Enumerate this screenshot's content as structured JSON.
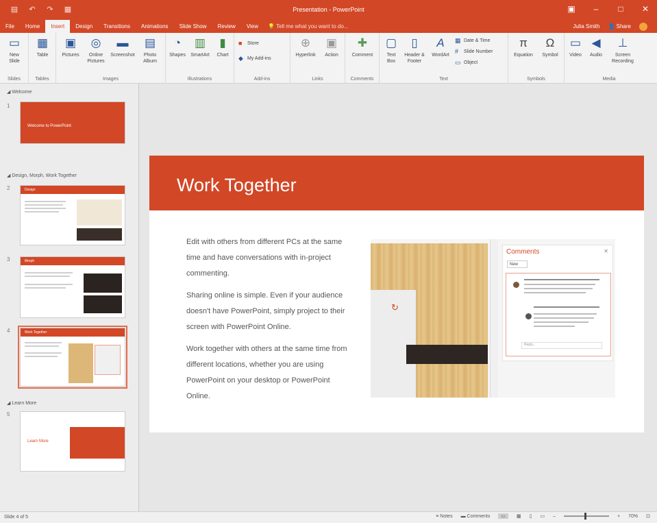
{
  "title_bar": {
    "document_title": "Presentation - PowerPoint",
    "quick_access": [
      "save-icon",
      "undo-icon",
      "redo-icon",
      "start-slideshow-icon"
    ],
    "window_controls": {
      "restore_ribbon": "▣",
      "minimize": "–",
      "maximize": "□",
      "close": "✕"
    }
  },
  "tabs": [
    {
      "label": "File"
    },
    {
      "label": "Home"
    },
    {
      "label": "Insert",
      "active": true
    },
    {
      "label": "Design"
    },
    {
      "label": "Transitions"
    },
    {
      "label": "Animations"
    },
    {
      "label": "Slide Show"
    },
    {
      "label": "Review"
    },
    {
      "label": "View"
    }
  ],
  "tell_me": "Tell me what you want to do...",
  "tab_right": {
    "user": "Julia Smith",
    "share": "Share"
  },
  "ribbon": {
    "groups": [
      {
        "label": "Slides",
        "buttons": [
          {
            "label": "New Slide",
            "icon": "new-slide-icon"
          }
        ]
      },
      {
        "label": "Tables",
        "buttons": [
          {
            "label": "Table",
            "icon": "table-icon"
          }
        ]
      },
      {
        "label": "Images",
        "buttons": [
          {
            "label": "Pictures",
            "icon": "pictures-icon"
          },
          {
            "label": "Online Pictures",
            "icon": "online-pictures-icon"
          },
          {
            "label": "Screenshot",
            "icon": "screenshot-icon"
          },
          {
            "label": "Photo Album",
            "icon": "photo-album-icon"
          }
        ]
      },
      {
        "label": "Illustrations",
        "buttons": [
          {
            "label": "Shapes",
            "icon": "shapes-icon"
          },
          {
            "label": "SmartArt",
            "icon": "smartart-icon"
          },
          {
            "label": "Chart",
            "icon": "chart-icon"
          }
        ]
      },
      {
        "label": "Add-ins",
        "buttons": [
          {
            "label": "Store",
            "icon": "store-icon"
          },
          {
            "label": "My Add-ins",
            "icon": "my-addins-icon"
          }
        ]
      },
      {
        "label": "Links",
        "buttons": [
          {
            "label": "Hyperlink",
            "icon": "hyperlink-icon"
          },
          {
            "label": "Action",
            "icon": "action-icon"
          }
        ]
      },
      {
        "label": "Comments",
        "buttons": [
          {
            "label": "Comment",
            "icon": "comment-icon"
          }
        ]
      },
      {
        "label": "Text",
        "buttons": [
          {
            "label": "Text Box",
            "icon": "text-box-icon"
          },
          {
            "label": "Header & Footer",
            "icon": "header-footer-icon"
          },
          {
            "label": "WordArt",
            "icon": "wordart-icon"
          },
          {
            "label": "Date & Time",
            "icon": "date-time-icon"
          },
          {
            "label": "Slide Number",
            "icon": "slide-number-icon"
          },
          {
            "label": "Object",
            "icon": "object-icon"
          }
        ]
      },
      {
        "label": "Symbols",
        "buttons": [
          {
            "label": "Equation",
            "icon": "equation-icon"
          },
          {
            "label": "Symbol",
            "icon": "symbol-icon"
          }
        ]
      },
      {
        "label": "Media",
        "buttons": [
          {
            "label": "Video",
            "icon": "video-icon"
          },
          {
            "label": "Audio",
            "icon": "audio-icon"
          },
          {
            "label": "Screen Recording",
            "icon": "screen-recording-icon"
          }
        ]
      }
    ]
  },
  "thumbnails": {
    "sections": [
      {
        "label": "Welcome"
      },
      {
        "label": "Design, Morph, Work Together"
      },
      {
        "label": "Learn More"
      }
    ],
    "slides": [
      {
        "num": "1",
        "heading": "Welcome to PowerPoint"
      },
      {
        "num": "2",
        "heading": "Design"
      },
      {
        "num": "3",
        "heading": "Morph"
      },
      {
        "num": "4",
        "heading": "Work Together",
        "selected": true
      },
      {
        "num": "5",
        "heading": "Learn More"
      }
    ]
  },
  "slide": {
    "title": "Work Together",
    "paragraphs": [
      "Edit with others from different PCs at the same time and have conversations with in-project commenting.",
      "Sharing online is simple. Even if your audience doesn't have PowerPoint, simply project to their screen with PowerPoint Online.",
      "Work together with others at the same time from different locations, whether you are using PowerPoint on your desktop or PowerPoint Online."
    ],
    "comments_pane": {
      "title": "Comments",
      "new_label": "New",
      "close": "✕",
      "reply_placeholder": "Reply..."
    }
  },
  "status_bar": {
    "slide_counter": "Slide 4 of 5",
    "notes": "Notes",
    "comments": "Comments",
    "zoom": "70%"
  },
  "colors": {
    "accent": "#d24726",
    "ribbon_bg": "#f3f3f3"
  }
}
